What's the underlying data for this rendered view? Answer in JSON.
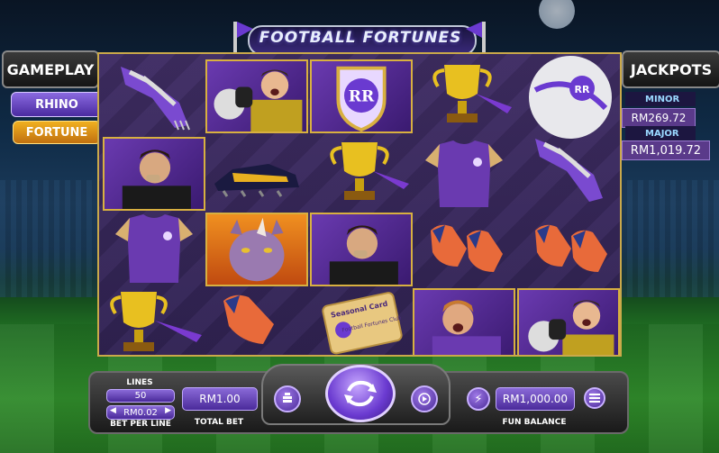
{
  "title": "FOOTBALL FORTUNES",
  "left_panel": {
    "gameplay_label": "GAMEPLAY",
    "rhino_label": "RHINO",
    "fortune_label": "FORTUNE"
  },
  "jackpots": {
    "header": "JACKPOTS",
    "minor_label": "MINOR",
    "minor_value": "RM269.72",
    "major_label": "MAJOR",
    "major_value": "RM1,019.72"
  },
  "reels": {
    "symbols": [
      [
        "scarf-icon",
        "goalkeeper-icon",
        "club-crest-icon",
        "trophy-icon",
        "football-icon"
      ],
      [
        "referee-icon",
        "boot-icon",
        "trophy-icon",
        "jersey-icon",
        "scarf-icon"
      ],
      [
        "jersey-icon",
        "rhino-icon",
        "referee-icon",
        "gloves-icon",
        "gloves-icon"
      ],
      [
        "trophy-icon",
        "gloves-icon",
        "seasonal-card-icon",
        "striker-icon",
        "goalkeeper-icon"
      ]
    ],
    "card_text": "Seasonal Card",
    "card_subtext": "Football Fortunes Club"
  },
  "controls": {
    "lines_label": "LINES",
    "lines_value": "50",
    "bet_per_line_value": "RM0.02",
    "bet_per_line_label": "BET PER LINE",
    "total_bet_value": "RM1.00",
    "total_bet_label": "TOTAL BET",
    "balance_value": "RM1,000.00",
    "balance_label": "FUN BALANCE"
  },
  "colors": {
    "accent_purple": "#6a3ad0",
    "gold": "#d8b040",
    "fortune_orange": "#f0a020"
  }
}
